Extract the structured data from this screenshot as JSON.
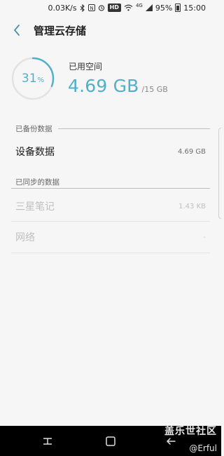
{
  "status_bar": {
    "speed": "0.03K/s",
    "hd": "HD",
    "network": "4G",
    "battery": "95%",
    "time": "15:00"
  },
  "header": {
    "title": "管理云存储"
  },
  "storage": {
    "percent_label": "31",
    "percent_sign": "%",
    "used_label": "已用空间",
    "used_value": "4.69 GB",
    "total_value": "/15 GB",
    "percent_fraction": 0.31,
    "accent_color": "#4fb0c8"
  },
  "backup_section": {
    "header": "已备份数据",
    "items": [
      {
        "label": "设备数据",
        "value": "4.69 GB"
      }
    ]
  },
  "sync_section": {
    "header": "已同步的数据",
    "items": [
      {
        "label": "三星笔记",
        "value": "1.43 KB"
      },
      {
        "label": "网络",
        "value": "-"
      }
    ]
  },
  "watermark": {
    "title": "盖乐世社区",
    "user": "@Erful"
  }
}
